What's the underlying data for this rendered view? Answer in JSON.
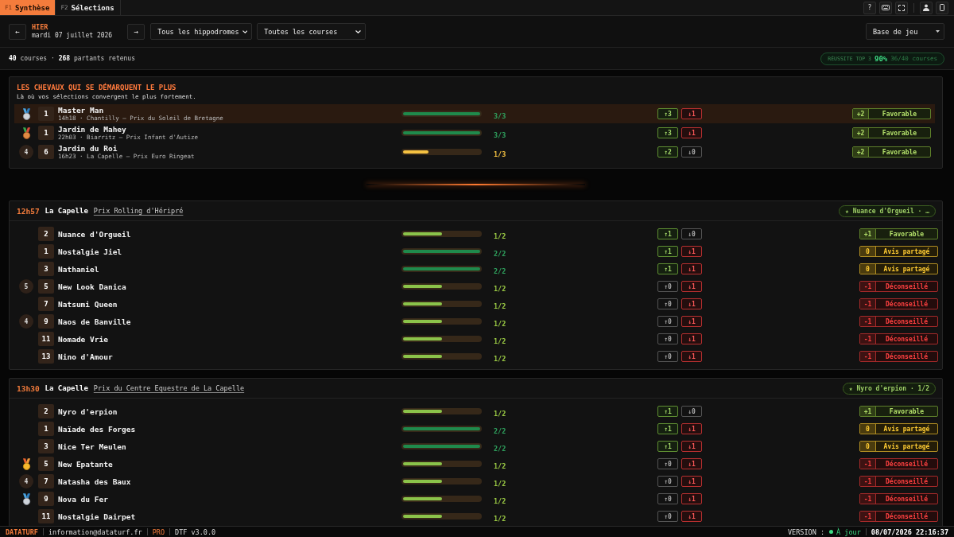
{
  "tabs": [
    {
      "key": "F1",
      "label": "Synthèse",
      "selected": true
    },
    {
      "key": "F2",
      "label": "Sélections",
      "selected": false
    }
  ],
  "tool_groups": [
    [
      {
        "kind": "help",
        "label": "?"
      },
      {
        "kind": "keyboard"
      },
      {
        "kind": "fullscreen"
      }
    ],
    [
      {
        "kind": "user"
      },
      {
        "kind": "tablet"
      }
    ]
  ],
  "date_nav": {
    "prev": "←",
    "day": "HIER",
    "date": "mardi 07 juillet 2026",
    "next": "→"
  },
  "filters": [
    {
      "value": "Tous les hippodromes"
    },
    {
      "value": "Toutes les courses"
    }
  ],
  "mode_select": {
    "value": "Base de jeu"
  },
  "summary": "**40** courses · **268** partants retenus",
  "success_badge": {
    "label": "RÉUSSITE TOP 3",
    "rate": "90%",
    "detail": "36/40 courses"
  },
  "highlights": {
    "title": "LES CHEVAUX QUI SE DÉMARQUENT LE PLUS",
    "subtitle": "Là où vos sélections convergent le plus fortement.",
    "rows": [
      {
        "selected": true,
        "kind": "silver",
        "number": "1",
        "name": "Master Man",
        "race": "14h18 · Chantilly — Prix du Soleil de Bretagne",
        "score": "3/3",
        "level": 1,
        "up": {
          "label": "↑3",
          "on": true
        },
        "down": {
          "label": "↓1",
          "on": true
        },
        "verdict": {
          "kind": "favorable",
          "points": "+2",
          "label": "Favorable"
        }
      },
      {
        "selected": false,
        "kind": "bronze",
        "number": "1",
        "name": "Jardin de Mahey",
        "race": "22h03 · Biarritz — Prix Infant d'Autize",
        "score": "3/3",
        "level": 1,
        "up": {
          "label": "↑3",
          "on": true
        },
        "down": {
          "label": "↓1",
          "on": true
        },
        "verdict": {
          "kind": "favorable",
          "points": "+2",
          "label": "Favorable"
        }
      },
      {
        "selected": false,
        "kind": "ranked",
        "rank": "4",
        "number": "6",
        "name": "Jardin du Roi",
        "race": "16h23 · La Capelle — Prix Euro Ringeat",
        "score": "1/3",
        "level": 0.33,
        "up": {
          "label": "↑2",
          "on": true
        },
        "down": {
          "label": "↓0",
          "on": false
        },
        "verdict": {
          "kind": "favorable",
          "points": "+2",
          "label": "Favorable"
        }
      }
    ]
  },
  "races": [
    {
      "time": "12h57",
      "venue": "La Capelle",
      "name": "Prix Rolling d'Héripré",
      "pick": "★ Nuance d'Orgueil · …",
      "runners": [
        {
          "kind": "plain",
          "number": "2",
          "name": "Nuance d'Orgueil",
          "score": "1/2",
          "level": 0.5,
          "up": {
            "label": "↑1",
            "on": true
          },
          "down": {
            "label": "↓0",
            "on": false
          },
          "verdict": {
            "kind": "favorable",
            "points": "+1",
            "label": "Favorable"
          }
        },
        {
          "kind": "plain",
          "number": "1",
          "name": "Nostalgie Jiel",
          "score": "2/2",
          "level": 1,
          "up": {
            "label": "↑1",
            "on": true
          },
          "down": {
            "label": "↓1",
            "on": true
          },
          "verdict": {
            "kind": "mixed",
            "points": "0",
            "label": "Avis partagé"
          }
        },
        {
          "kind": "plain",
          "number": "3",
          "name": "Nathaniel",
          "score": "2/2",
          "level": 1,
          "up": {
            "label": "↑1",
            "on": true
          },
          "down": {
            "label": "↓1",
            "on": true
          },
          "verdict": {
            "kind": "mixed",
            "points": "0",
            "label": "Avis partagé"
          }
        },
        {
          "kind": "ranked",
          "rank": "5",
          "number": "5",
          "name": "New Look Danica",
          "score": "1/2",
          "level": 0.5,
          "up": {
            "label": "↑0",
            "on": false
          },
          "down": {
            "label": "↓1",
            "on": true
          },
          "verdict": {
            "kind": "against",
            "points": "-1",
            "label": "Déconseillé"
          }
        },
        {
          "kind": "plain",
          "number": "7",
          "name": "Natsumi Queen",
          "score": "1/2",
          "level": 0.5,
          "up": {
            "label": "↑0",
            "on": false
          },
          "down": {
            "label": "↓1",
            "on": true
          },
          "verdict": {
            "kind": "against",
            "points": "-1",
            "label": "Déconseillé"
          }
        },
        {
          "kind": "ranked",
          "rank": "4",
          "number": "9",
          "name": "Naos de Banville",
          "score": "1/2",
          "level": 0.5,
          "up": {
            "label": "↑0",
            "on": false
          },
          "down": {
            "label": "↓1",
            "on": true
          },
          "verdict": {
            "kind": "against",
            "points": "-1",
            "label": "Déconseillé"
          }
        },
        {
          "kind": "plain",
          "number": "11",
          "name": "Nomade Vrie",
          "score": "1/2",
          "level": 0.5,
          "up": {
            "label": "↑0",
            "on": false
          },
          "down": {
            "label": "↓1",
            "on": true
          },
          "verdict": {
            "kind": "against",
            "points": "-1",
            "label": "Déconseillé"
          }
        },
        {
          "kind": "plain",
          "number": "13",
          "name": "Nino d'Amour",
          "score": "1/2",
          "level": 0.5,
          "up": {
            "label": "↑0",
            "on": false
          },
          "down": {
            "label": "↓1",
            "on": true
          },
          "verdict": {
            "kind": "against",
            "points": "-1",
            "label": "Déconseillé"
          }
        }
      ]
    },
    {
      "time": "13h30",
      "venue": "La Capelle",
      "name": "Prix du Centre Equestre de La Capelle",
      "pick": "★ Nyro d'erpion · 1/2",
      "runners": [
        {
          "kind": "plain",
          "number": "2",
          "name": "Nyro d'erpion",
          "score": "1/2",
          "level": 0.5,
          "up": {
            "label": "↑1",
            "on": true
          },
          "down": {
            "label": "↓0",
            "on": false
          },
          "verdict": {
            "kind": "favorable",
            "points": "+1",
            "label": "Favorable"
          }
        },
        {
          "kind": "plain",
          "number": "1",
          "name": "Naïade des Forges",
          "score": "2/2",
          "level": 1,
          "up": {
            "label": "↑1",
            "on": true
          },
          "down": {
            "label": "↓1",
            "on": true
          },
          "verdict": {
            "kind": "mixed",
            "points": "0",
            "label": "Avis partagé"
          }
        },
        {
          "kind": "plain",
          "number": "3",
          "name": "Nice Ter Meulen",
          "score": "2/2",
          "level": 1,
          "up": {
            "label": "↑1",
            "on": true
          },
          "down": {
            "label": "↓1",
            "on": true
          },
          "verdict": {
            "kind": "mixed",
            "points": "0",
            "label": "Avis partagé"
          }
        },
        {
          "kind": "gold",
          "number": "5",
          "name": "New Epatante",
          "score": "1/2",
          "level": 0.5,
          "up": {
            "label": "↑0",
            "on": false
          },
          "down": {
            "label": "↓1",
            "on": true
          },
          "verdict": {
            "kind": "against",
            "points": "-1",
            "label": "Déconseillé"
          }
        },
        {
          "kind": "ranked",
          "rank": "4",
          "number": "7",
          "name": "Natasha des Baux",
          "score": "1/2",
          "level": 0.5,
          "up": {
            "label": "↑0",
            "on": false
          },
          "down": {
            "label": "↓1",
            "on": true
          },
          "verdict": {
            "kind": "against",
            "points": "-1",
            "label": "Déconseillé"
          }
        },
        {
          "kind": "silver",
          "number": "9",
          "name": "Nova du Fer",
          "score": "1/2",
          "level": 0.5,
          "up": {
            "label": "↑0",
            "on": false
          },
          "down": {
            "label": "↓1",
            "on": true
          },
          "verdict": {
            "kind": "against",
            "points": "-1",
            "label": "Déconseillé"
          }
        },
        {
          "kind": "plain",
          "number": "11",
          "name": "Nostalgie Dairpet",
          "score": "1/2",
          "level": 0.5,
          "up": {
            "label": "↑0",
            "on": false
          },
          "down": {
            "label": "↓1",
            "on": true
          },
          "verdict": {
            "kind": "against",
            "points": "-1",
            "label": "Déconseillé"
          }
        }
      ]
    }
  ],
  "footer": {
    "brand": "DATATURF",
    "email": "information@dataturf.fr",
    "plan": "PRO",
    "build": "DTF v3.0.0",
    "version_label": "VERSION :",
    "status": "À jour",
    "timestamp": "08/07/2026 22:16:37"
  }
}
